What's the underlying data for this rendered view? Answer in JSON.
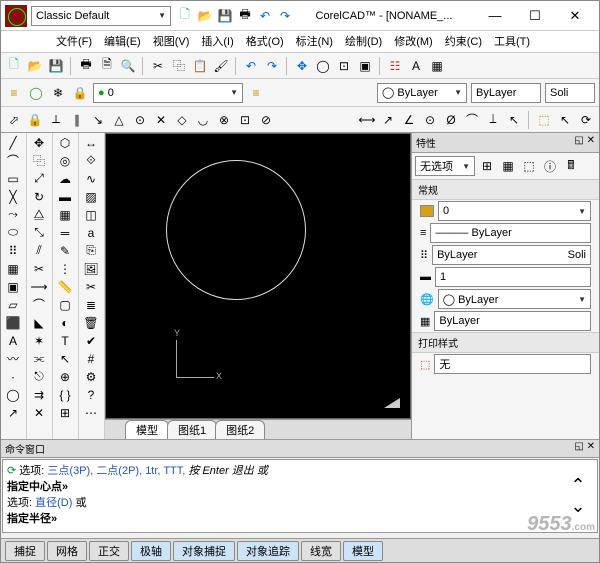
{
  "titlebar": {
    "workspace": "Classic Default",
    "title": "CorelCAD™ - [NONAME_...",
    "icons": [
      "new-doc",
      "open",
      "save",
      "print",
      "undo",
      "redo"
    ],
    "window": {
      "min": "—",
      "max": "☐",
      "close": "✕"
    }
  },
  "menu": {
    "file": "文件(F)",
    "edit": "编辑(E)",
    "view": "视图(V)",
    "insert": "插入(I)",
    "format": "格式(O)",
    "annotate": "标注(N)",
    "draw": "绘制(D)",
    "modify": "修改(M)",
    "constraints": "约束(C)",
    "tools": "工具(T)"
  },
  "layer_row": {
    "layer_combo": "0",
    "color_combo": "ByLayer",
    "linetype_combo": "ByLayer",
    "lineweight_combo": "Soli"
  },
  "tabs": {
    "model": "模型",
    "sheet1": "图纸1",
    "sheet2": "图纸2"
  },
  "canvas": {
    "x_label": "X",
    "y_label": "Y"
  },
  "props": {
    "panel_title": "特性",
    "selection": "无选项",
    "sect_general": "常规",
    "layer": "0",
    "color": "ByLayer",
    "linetype": "ByLayer",
    "linetype2": "Soli",
    "lineweight": "1",
    "layer2": "ByLayer",
    "transp": "ByLayer",
    "sect_print": "打印样式",
    "print_style": "无"
  },
  "cmd": {
    "title": "命令窗口",
    "line1_pre": "选项: ",
    "line1_links": "三点(3P), 二点(2P), 1tr, TTT,",
    "line1_post": " 按 Enter 退出 或",
    "line2": "指定中心点»",
    "line3_pre": "选项: ",
    "line3_links": "直径(D)",
    "line3_post": " 或",
    "line4": "指定半径»"
  },
  "status": {
    "snap": "捕捉",
    "grid": "网格",
    "ortho": "正交",
    "polar": "极轴",
    "osnap": "对象捕捉",
    "otrack": "对象追踪",
    "lwt": "线宽",
    "model": "模型"
  },
  "watermark": {
    "big": "9553",
    "small": ".com"
  }
}
